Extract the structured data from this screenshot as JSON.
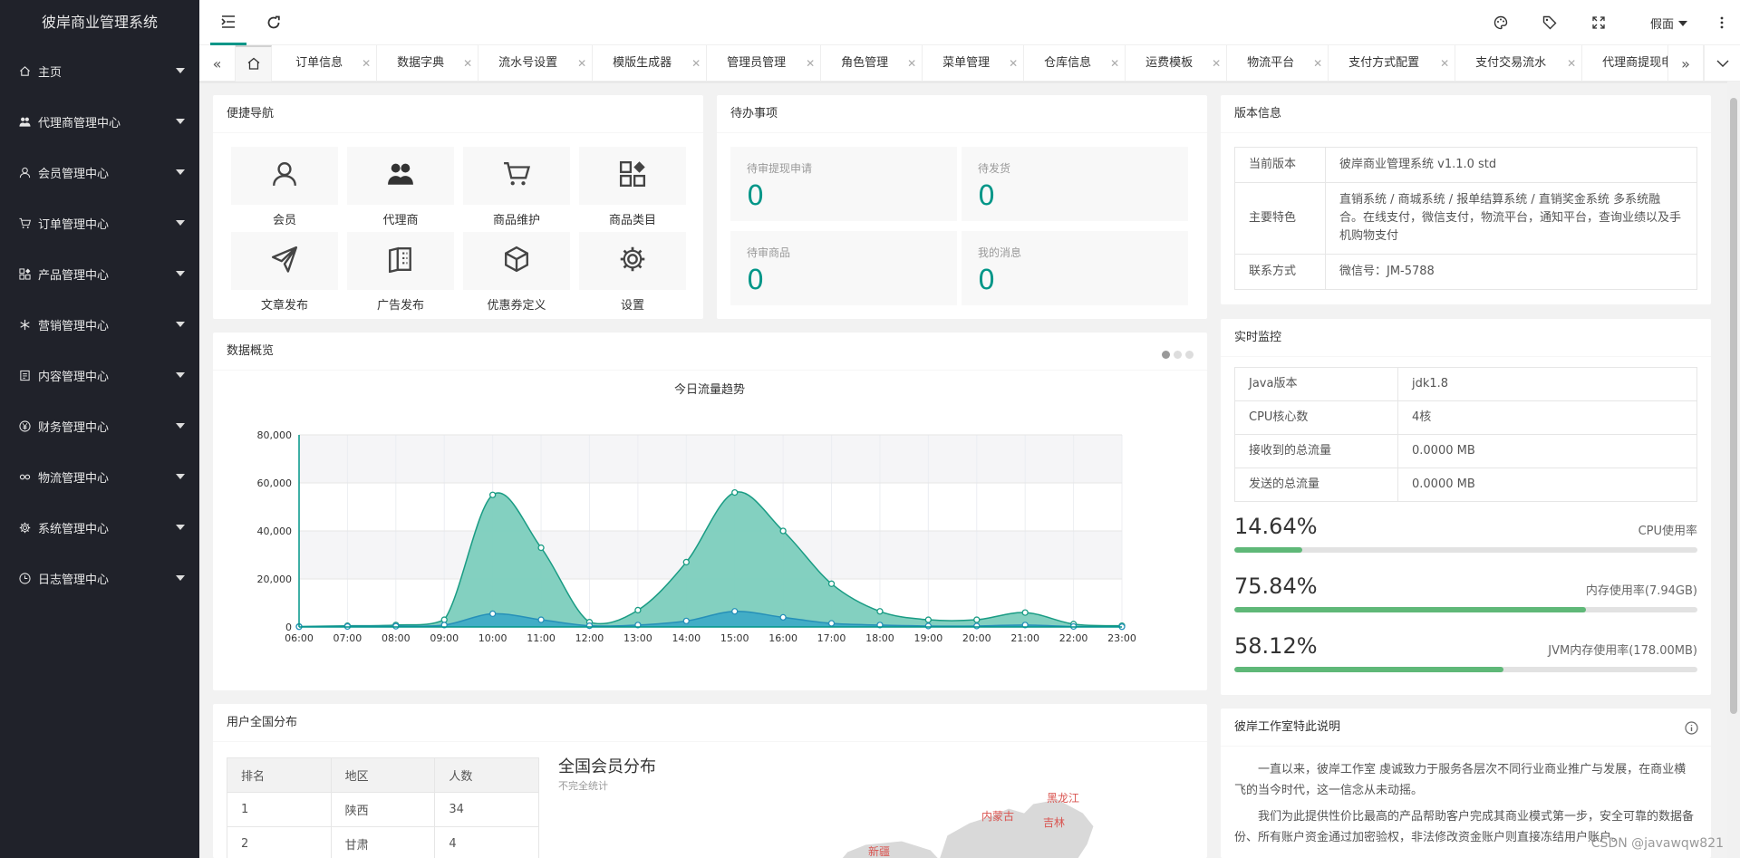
{
  "app": {
    "title": "彼岸商业管理系统"
  },
  "sidebar": {
    "items": [
      {
        "label": "主页",
        "icon": "home-icon"
      },
      {
        "label": "代理商管理中心",
        "icon": "users-icon"
      },
      {
        "label": "会员管理中心",
        "icon": "user-icon"
      },
      {
        "label": "订单管理中心",
        "icon": "cart-icon"
      },
      {
        "label": "产品管理中心",
        "icon": "app-icon"
      },
      {
        "label": "营销管理中心",
        "icon": "snowflake-icon"
      },
      {
        "label": "内容管理中心",
        "icon": "note-icon"
      },
      {
        "label": "财务管理中心",
        "icon": "rmb-icon"
      },
      {
        "label": "物流管理中心",
        "icon": "link-icon"
      },
      {
        "label": "系统管理中心",
        "icon": "gear-icon"
      },
      {
        "label": "日志管理中心",
        "icon": "clock-icon"
      }
    ]
  },
  "header": {
    "user": "假面"
  },
  "tabs": [
    "订单信息",
    "数据字典",
    "流水号设置",
    "模版生成器",
    "管理员管理",
    "角色管理",
    "菜单管理",
    "仓库信息",
    "运费模板",
    "物流平台",
    "支付方式配置",
    "支付交易流水",
    "代理商提现申"
  ],
  "shortcuts": {
    "title": "便捷导航",
    "items": [
      {
        "label": "会员",
        "icon": "user-icon"
      },
      {
        "label": "代理商",
        "icon": "users-icon"
      },
      {
        "label": "商品维护",
        "icon": "cart-icon"
      },
      {
        "label": "商品类目",
        "icon": "app-icon"
      },
      {
        "label": "文章发布",
        "icon": "send-icon"
      },
      {
        "label": "广告发布",
        "icon": "template-icon"
      },
      {
        "label": "优惠券定义",
        "icon": "cube-icon"
      },
      {
        "label": "设置",
        "icon": "gear-icon"
      }
    ]
  },
  "todo": {
    "title": "待办事项",
    "items": [
      {
        "label": "待审提现申请",
        "value": "0"
      },
      {
        "label": "待发货",
        "value": "0"
      },
      {
        "label": "待审商品",
        "value": "0"
      },
      {
        "label": "我的消息",
        "value": "0"
      }
    ]
  },
  "version": {
    "title": "版本信息",
    "rows": [
      {
        "key": "当前版本",
        "value": "彼岸商业管理系统 v1.1.0 std"
      },
      {
        "key": "主要特色",
        "value": "直销系统 / 商城系统 / 报单结算系统 / 直销奖金系统 多系统融合。在线支付，微信支付，物流平台，通知平台，查询业绩以及手机购物支付"
      },
      {
        "key": "联系方式",
        "value": "微信号：JM-5788"
      }
    ]
  },
  "overview": {
    "title": "数据概览"
  },
  "chart_data": {
    "type": "area",
    "title": "今日流量趋势",
    "x": [
      "06:00",
      "07:00",
      "08:00",
      "09:00",
      "10:00",
      "11:00",
      "12:00",
      "13:00",
      "14:00",
      "15:00",
      "16:00",
      "17:00",
      "18:00",
      "19:00",
      "20:00",
      "21:00",
      "22:00",
      "23:00"
    ],
    "xlabel": "",
    "ylabel": "",
    "yticks": [
      "0",
      "20,000",
      "40,000",
      "60,000",
      "80,000"
    ],
    "ylim": [
      0,
      80000
    ],
    "series": [
      {
        "color": "#7ccdbd",
        "line": "#1a9c84",
        "values": [
          200,
          500,
          800,
          3000,
          55000,
          33000,
          2000,
          7000,
          27000,
          56000,
          40000,
          18000,
          6500,
          3000,
          3000,
          6000,
          1200,
          500
        ]
      },
      {
        "color": "#37a7c7",
        "line": "#2690b8",
        "values": [
          100,
          200,
          300,
          800,
          5500,
          3000,
          500,
          800,
          2500,
          6500,
          4000,
          1500,
          800,
          400,
          400,
          800,
          200,
          100
        ]
      }
    ]
  },
  "monitor": {
    "title": "实时监控",
    "rows": [
      {
        "key": "Java版本",
        "value": "jdk1.8"
      },
      {
        "key": "CPU核心数",
        "value": "4核"
      },
      {
        "key": "接收到的总流量",
        "value": "0.0000 MB"
      },
      {
        "key": "发送的总流量",
        "value": "0.0000 MB"
      }
    ],
    "metrics": [
      {
        "value": "14.64%",
        "label": "CPU使用率",
        "fraction": 0.1464
      },
      {
        "value": "75.84%",
        "label": "内存使用率(7.94GB)",
        "fraction": 0.7584
      },
      {
        "value": "58.12%",
        "label": "JVM内存使用率(178.00MB)",
        "fraction": 0.5812
      }
    ]
  },
  "distribution": {
    "title": "用户全国分布",
    "headers": [
      "排名",
      "地区",
      "人数"
    ],
    "rows": [
      [
        "1",
        "陕西",
        "34"
      ],
      [
        "2",
        "甘肃",
        "4"
      ]
    ],
    "map_title": "全国会员分布",
    "map_subtitle": "不完全统计",
    "map_labels": [
      "黑龙江",
      "内蒙古",
      "吉林",
      "新疆"
    ]
  },
  "notice": {
    "title": "彼岸工作室特此说明",
    "p1": "一直以来，彼岸工作室 虔诚致力于服务各层次不同行业商业推广与发展，在商业横飞的当今时代，这一信念从未动摇。",
    "p2": "我们为此提供性价比最高的产品帮助客户完成其商业模式第一步，安全可靠的数据备份、所有账户资金通过加密验权，非法修改资金账户则直接冻结用户账户。"
  },
  "watermark": "CSDN @javawqw821"
}
